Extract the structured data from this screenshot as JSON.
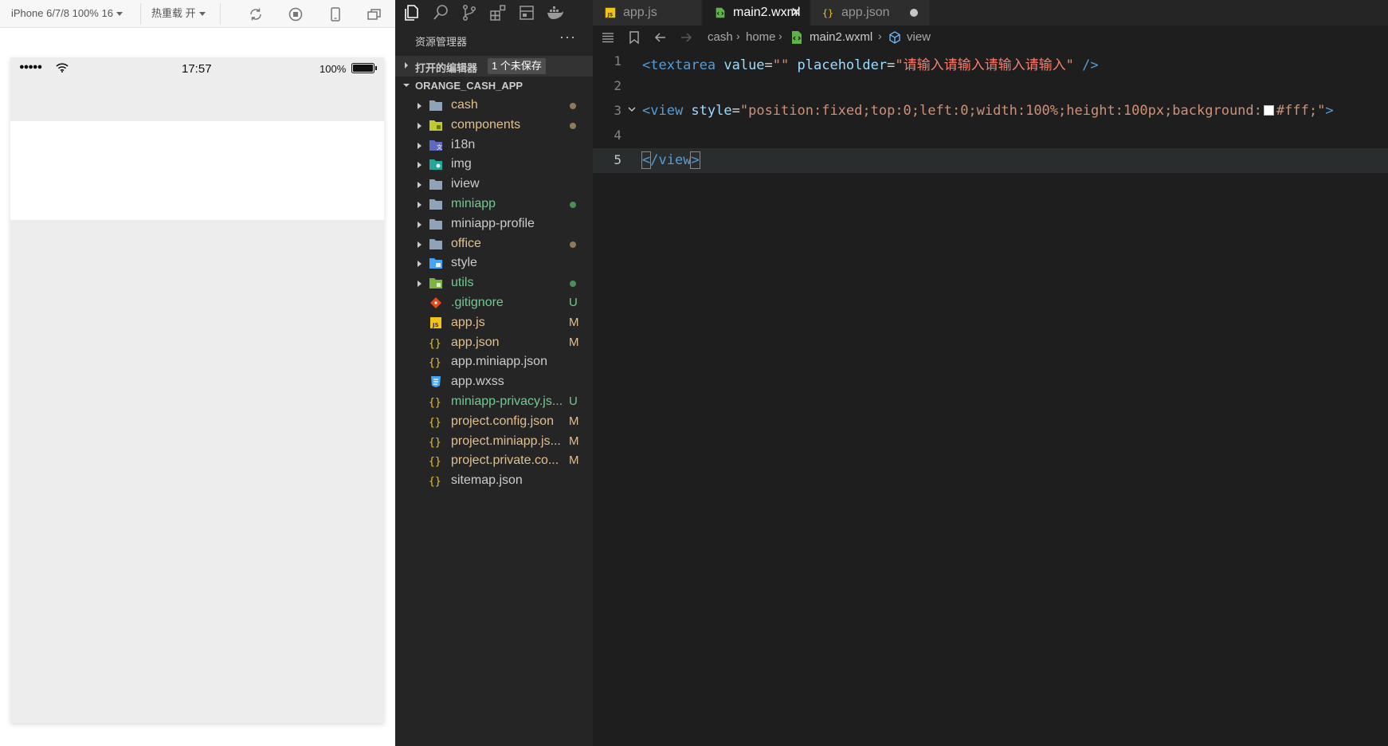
{
  "simulator": {
    "device_label": "iPhone 6/7/8 100% 16",
    "hot_reload_label": "热重载 开",
    "phone": {
      "carrier_dots": "●●●●●",
      "time": "17:57",
      "battery_percent": "100%"
    }
  },
  "explorer": {
    "title": "资源管理器",
    "more": "···",
    "open_editors": {
      "label": "打开的编辑器",
      "badge": "1 个未保存"
    },
    "project": {
      "label": "ORANGE_CASH_APP",
      "items": [
        {
          "name": "cash",
          "kind": "folder",
          "icon": "folder-icon",
          "status": "dot",
          "status_color": "#8f7b5a",
          "label_color": "#e2c08d"
        },
        {
          "name": "components",
          "kind": "folder",
          "icon": "components-folder-icon",
          "status": "dot",
          "status_color": "#8f7b5a",
          "label_color": "#e2c08d"
        },
        {
          "name": "i18n",
          "kind": "folder",
          "icon": "i18n-folder-icon",
          "status": "",
          "status_color": "",
          "label_color": "#cccccc"
        },
        {
          "name": "img",
          "kind": "folder",
          "icon": "image-folder-icon",
          "status": "",
          "status_color": "",
          "label_color": "#cccccc"
        },
        {
          "name": "iview",
          "kind": "folder",
          "icon": "folder-icon",
          "status": "",
          "status_color": "",
          "label_color": "#cccccc"
        },
        {
          "name": "miniapp",
          "kind": "folder",
          "icon": "folder-icon",
          "status": "dot",
          "status_color": "#4a8f55",
          "label_color": "#73c991"
        },
        {
          "name": "miniapp-profile",
          "kind": "folder",
          "icon": "folder-icon",
          "status": "",
          "status_color": "",
          "label_color": "#cccccc"
        },
        {
          "name": "office",
          "kind": "folder",
          "icon": "folder-icon",
          "status": "dot",
          "status_color": "#8f7b5a",
          "label_color": "#e2c08d"
        },
        {
          "name": "style",
          "kind": "folder",
          "icon": "style-folder-icon",
          "status": "",
          "status_color": "",
          "label_color": "#cccccc"
        },
        {
          "name": "utils",
          "kind": "folder",
          "icon": "utils-folder-icon",
          "status": "dot",
          "status_color": "#4a8f55",
          "label_color": "#73c991"
        },
        {
          "name": ".gitignore",
          "kind": "file",
          "icon": "git-icon",
          "status": "U",
          "status_color": "#73c991",
          "label_color": "#73c991"
        },
        {
          "name": "app.js",
          "kind": "file",
          "icon": "js-file-icon",
          "status": "M",
          "status_color": "#e2c08d",
          "label_color": "#e2c08d"
        },
        {
          "name": "app.json",
          "kind": "file",
          "icon": "json-file-icon",
          "status": "M",
          "status_color": "#e2c08d",
          "label_color": "#e2c08d"
        },
        {
          "name": "app.miniapp.json",
          "kind": "file",
          "icon": "json-file-icon",
          "status": "",
          "status_color": "",
          "label_color": "#cccccc"
        },
        {
          "name": "app.wxss",
          "kind": "file",
          "icon": "css-file-icon",
          "status": "",
          "status_color": "",
          "label_color": "#cccccc"
        },
        {
          "name": "miniapp-privacy.js...",
          "kind": "file",
          "icon": "json-file-icon",
          "status": "U",
          "status_color": "#73c991",
          "label_color": "#73c991"
        },
        {
          "name": "project.config.json",
          "kind": "file",
          "icon": "json-file-icon",
          "status": "M",
          "status_color": "#e2c08d",
          "label_color": "#e2c08d"
        },
        {
          "name": "project.miniapp.js...",
          "kind": "file",
          "icon": "json-file-icon",
          "status": "M",
          "status_color": "#e2c08d",
          "label_color": "#e2c08d"
        },
        {
          "name": "project.private.co...",
          "kind": "file",
          "icon": "json-file-icon",
          "status": "M",
          "status_color": "#e2c08d",
          "label_color": "#e2c08d"
        },
        {
          "name": "sitemap.json",
          "kind": "file",
          "icon": "json-file-icon",
          "status": "",
          "status_color": "",
          "label_color": "#cccccc"
        }
      ]
    }
  },
  "tabs": [
    {
      "label": "app.js",
      "icon": "js-file-icon",
      "active": false,
      "state": ""
    },
    {
      "label": "main2.wxml",
      "icon": "wxml-file-icon",
      "active": true,
      "state": "close"
    },
    {
      "label": "app.json",
      "icon": "json-file-icon",
      "active": false,
      "state": "unsaved"
    }
  ],
  "breadcrumb": {
    "items": [
      "cash",
      "home",
      "main2.wxml",
      "view"
    ]
  },
  "editor": {
    "current_line": 5,
    "lines": [
      {
        "n": "1",
        "tokens": [
          {
            "t": "<textarea",
            "c": "t-tag"
          },
          {
            "t": " value",
            "c": "t-attr"
          },
          {
            "t": "=",
            "c": "t-plain"
          },
          {
            "t": "\"\"",
            "c": "t-str"
          },
          {
            "t": " placeholder",
            "c": "t-attr"
          },
          {
            "t": "=",
            "c": "t-plain"
          },
          {
            "t": "\"",
            "c": "t-str"
          },
          {
            "t": "请输入请输入请输入请输入",
            "c": "t-str-cn"
          },
          {
            "t": "\"",
            "c": "t-str"
          },
          {
            "t": " />",
            "c": "t-tag"
          }
        ]
      },
      {
        "n": "2",
        "tokens": []
      },
      {
        "n": "3",
        "fold": true,
        "tokens": [
          {
            "t": "<view",
            "c": "t-tag"
          },
          {
            "t": " style",
            "c": "t-attr"
          },
          {
            "t": "=",
            "c": "t-plain"
          },
          {
            "t": "\"position:fixed;top:0;left:0;width:100%;height:100px;background:",
            "c": "t-str"
          },
          {
            "t": "",
            "c": "swatch"
          },
          {
            "t": "#fff;\"",
            "c": "t-str"
          },
          {
            "t": ">",
            "c": "t-tag"
          }
        ]
      },
      {
        "n": "4",
        "tokens": []
      },
      {
        "n": "5",
        "tokens": [
          {
            "t": "<",
            "c": "t-tag bracket-box"
          },
          {
            "t": "/view",
            "c": "t-tag"
          },
          {
            "t": ">",
            "c": "t-tag bracket-box"
          }
        ]
      }
    ]
  },
  "colors": {
    "explorer_bg": "#252526",
    "editor_bg": "#1e1e1e",
    "modified": "#e2c08d",
    "untracked": "#73c991"
  }
}
